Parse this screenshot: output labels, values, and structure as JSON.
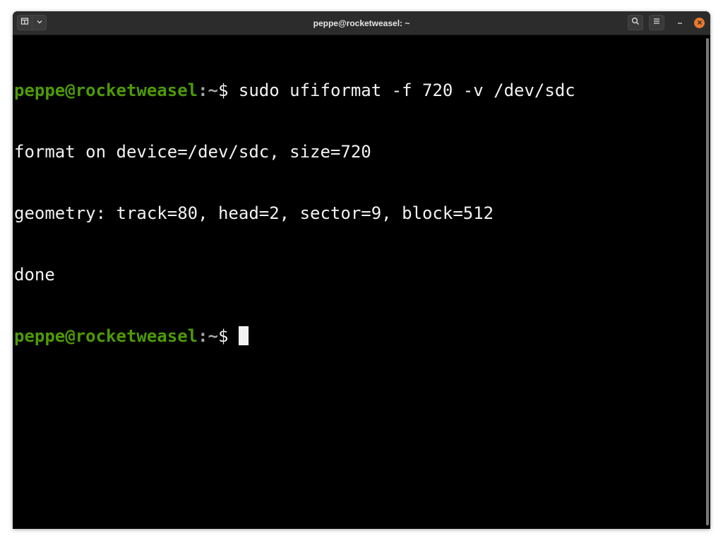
{
  "window": {
    "title": "peppe@rocketweasel: ~"
  },
  "terminal": {
    "prompt_user_host": "peppe@rocketweasel",
    "prompt_path": ":~",
    "prompt_symbol": "$ ",
    "command": "sudo ufiformat -f 720 -v /dev/sdc",
    "output_lines": [
      "format on device=/dev/sdc, size=720",
      "geometry: track=80, head=2, sector=9, block=512",
      "done"
    ]
  },
  "colors": {
    "prompt_user": "#4e9a06",
    "text": "#f2f2f2",
    "background": "#000000",
    "close_button": "#e9782c"
  },
  "icons": {
    "new_tab": "new-tab-icon",
    "menu_dropdown": "chevron-down-icon",
    "search": "search-icon",
    "hamburger": "hamburger-menu-icon",
    "minimize": "minimize-icon",
    "close": "close-icon"
  }
}
